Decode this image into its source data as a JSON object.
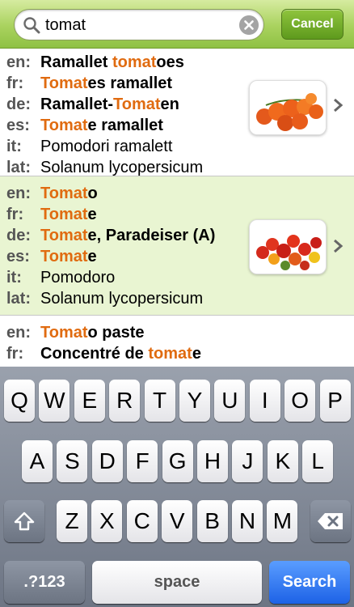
{
  "search": {
    "query": "tomat",
    "cancel_label": "Cancel"
  },
  "results": [
    {
      "lines": [
        {
          "lang": "en:",
          "parts": [
            {
              "t": "Ramallet "
            },
            {
              "t": "tomat",
              "hl": true
            },
            {
              "t": "oes"
            }
          ],
          "bold": true
        },
        {
          "lang": "fr:",
          "parts": [
            {
              "t": "Tomat",
              "hl": true
            },
            {
              "t": "es ramallet"
            }
          ],
          "bold": true
        },
        {
          "lang": "de:",
          "parts": [
            {
              "t": "Ramallet-"
            },
            {
              "t": "Tomat",
              "hl": true
            },
            {
              "t": "en"
            }
          ],
          "bold": true
        },
        {
          "lang": "es:",
          "parts": [
            {
              "t": "Tomat",
              "hl": true
            },
            {
              "t": "e ramallet"
            }
          ],
          "bold": true
        },
        {
          "lang": "it:",
          "parts": [
            {
              "t": "Pomodori ramalett"
            }
          ],
          "bold": false
        },
        {
          "lang": "lat:",
          "parts": [
            {
              "t": "Solanum lycopersicum"
            }
          ],
          "bold": false
        }
      ]
    },
    {
      "lines": [
        {
          "lang": "en:",
          "parts": [
            {
              "t": "Tomat",
              "hl": true
            },
            {
              "t": "o"
            }
          ],
          "bold": true
        },
        {
          "lang": "fr:",
          "parts": [
            {
              "t": "Tomat",
              "hl": true
            },
            {
              "t": "e"
            }
          ],
          "bold": true
        },
        {
          "lang": "de:",
          "parts": [
            {
              "t": "Tomat",
              "hl": true
            },
            {
              "t": "e, Paradeiser (A)"
            }
          ],
          "bold": true
        },
        {
          "lang": "es:",
          "parts": [
            {
              "t": "Tomat",
              "hl": true
            },
            {
              "t": "e"
            }
          ],
          "bold": true
        },
        {
          "lang": "it:",
          "parts": [
            {
              "t": "Pomodoro"
            }
          ],
          "bold": false
        },
        {
          "lang": "lat:",
          "parts": [
            {
              "t": "Solanum lycopersicum"
            }
          ],
          "bold": false
        }
      ]
    },
    {
      "lines": [
        {
          "lang": "en:",
          "parts": [
            {
              "t": "Tomat",
              "hl": true
            },
            {
              "t": "o paste"
            }
          ],
          "bold": true
        },
        {
          "lang": "fr:",
          "parts": [
            {
              "t": "Concentré de "
            },
            {
              "t": "tomat",
              "hl": true
            },
            {
              "t": "e"
            }
          ],
          "bold": true
        }
      ]
    }
  ],
  "keyboard": {
    "row1": [
      "Q",
      "W",
      "E",
      "R",
      "T",
      "Y",
      "U",
      "I",
      "O",
      "P"
    ],
    "row2": [
      "A",
      "S",
      "D",
      "F",
      "G",
      "H",
      "J",
      "K",
      "L"
    ],
    "row3": [
      "Z",
      "X",
      "C",
      "V",
      "B",
      "N",
      "M"
    ],
    "numbers_label": ".?123",
    "space_label": "space",
    "search_label": "Search"
  },
  "colors": {
    "highlight": "#e06b10",
    "header_green": "#a9d25e",
    "row_alt": "#e9f5d2"
  }
}
